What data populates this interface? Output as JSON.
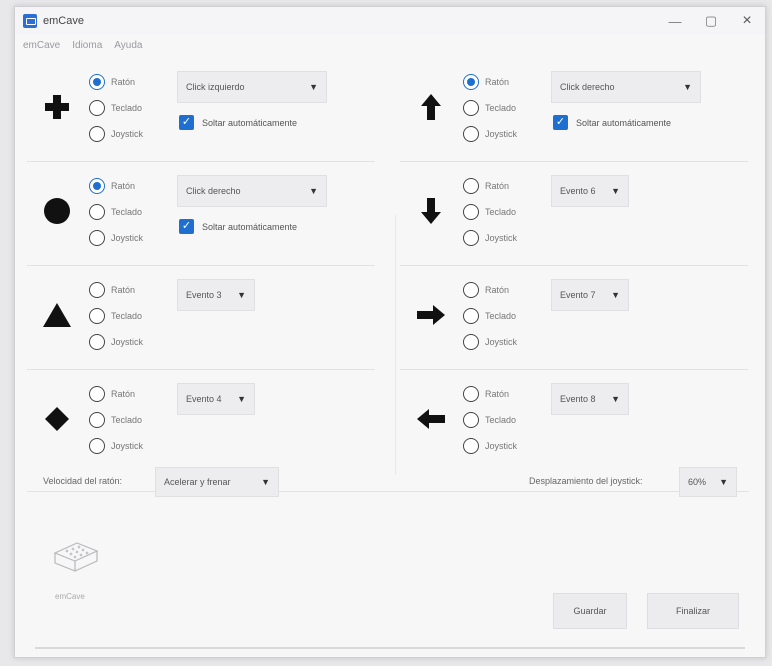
{
  "window": {
    "title": "emCave",
    "minimize": "—",
    "maximize": "▢",
    "close": "×"
  },
  "menu": [
    "emCave",
    "Idioma",
    "Ayuda"
  ],
  "radio_labels": [
    "Ratón",
    "Teclado",
    "Joystick"
  ],
  "events": [
    {
      "id": "cross",
      "selected": 0,
      "dropdown": "Click izquierdo",
      "auto_release": true,
      "auto_release_label": "Soltar automáticamente"
    },
    {
      "id": "circle",
      "selected": 0,
      "dropdown": "Click derecho",
      "auto_release": true,
      "auto_release_label": "Soltar automáticamente"
    },
    {
      "id": "triangle",
      "selected": -1,
      "dropdown": "Evento 3",
      "auto_release": false
    },
    {
      "id": "diamond",
      "selected": -1,
      "dropdown": "Evento 4",
      "auto_release": false
    },
    {
      "id": "arrow-up",
      "selected": 0,
      "dropdown": "Click derecho",
      "auto_release": true,
      "auto_release_label": "Soltar automáticamente"
    },
    {
      "id": "arrow-down",
      "selected": -1,
      "dropdown": "Evento 6",
      "auto_release": false
    },
    {
      "id": "arrow-right",
      "selected": -1,
      "dropdown": "Evento 7",
      "auto_release": false
    },
    {
      "id": "arrow-left",
      "selected": -1,
      "dropdown": "Evento 8",
      "auto_release": false
    }
  ],
  "bottom": {
    "speed_label": "Velocidad del ratón:",
    "speed_value": "Acelerar y frenar",
    "joystick_label": "Desplazamiento del joystick:",
    "joystick_value": "60%"
  },
  "logo_text": "emCave",
  "buttons": {
    "save": "Guardar",
    "finish": "Finalizar"
  },
  "colors": {
    "accent": "#1f6fd1",
    "window_bg": "#f7f7f8"
  }
}
